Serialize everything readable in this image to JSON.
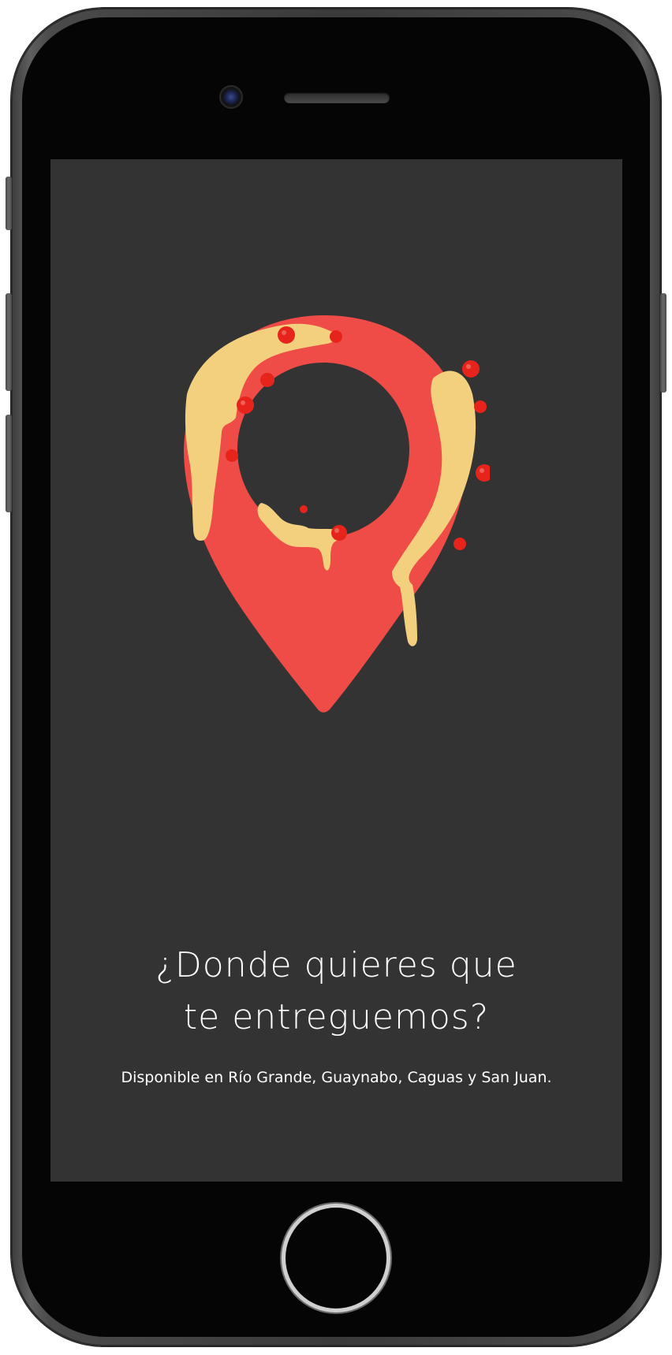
{
  "screen": {
    "headline_line1": "¿Donde quieres que",
    "headline_line2": "te entreguemos?",
    "subtext": "Disponible en Río Grande, Guaynabo, Caguas y San Juan.",
    "illustration": "pizza-location-pin-icon"
  },
  "colors": {
    "screen_background": "#333333",
    "pin_red": "#EF4B47",
    "cheese": "#F3D07E",
    "pepperoni": "#E7241C",
    "text": "#FFFFFF"
  }
}
